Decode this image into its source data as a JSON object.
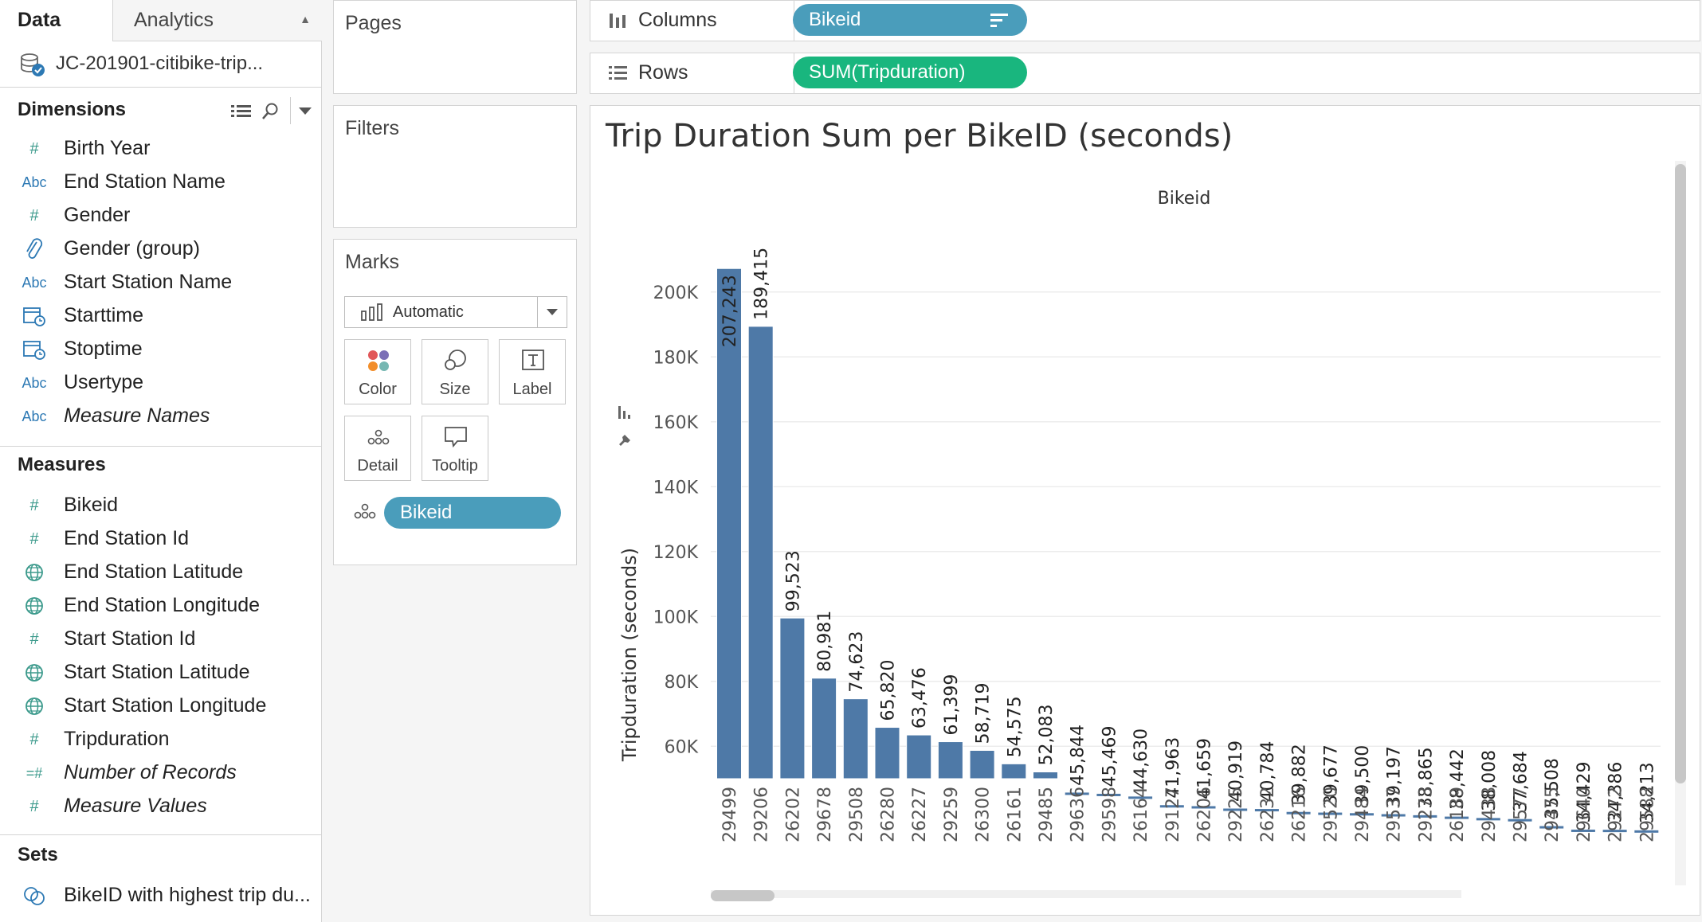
{
  "data_pane": {
    "tab_data": "Data",
    "tab_analytics": "Analytics",
    "datasource": "JC-201901-citibike-trip...",
    "dimensions_title": "Dimensions",
    "dimensions": [
      {
        "label": "Birth Year",
        "icon": "number-icon",
        "italic": false
      },
      {
        "label": "End Station Name",
        "icon": "string-icon",
        "italic": false
      },
      {
        "label": "Gender",
        "icon": "number-icon",
        "italic": false
      },
      {
        "label": "Gender (group)",
        "icon": "paperclip-icon",
        "italic": false
      },
      {
        "label": "Start Station Name",
        "icon": "string-icon",
        "italic": false
      },
      {
        "label": "Starttime",
        "icon": "datetime-icon",
        "italic": false
      },
      {
        "label": "Stoptime",
        "icon": "datetime-icon",
        "italic": false
      },
      {
        "label": "Usertype",
        "icon": "string-icon",
        "italic": false
      },
      {
        "label": "Measure Names",
        "icon": "string-icon",
        "italic": true
      }
    ],
    "measures_title": "Measures",
    "measures": [
      {
        "label": "Bikeid",
        "icon": "number-icon",
        "italic": false
      },
      {
        "label": "End Station Id",
        "icon": "number-icon",
        "italic": false
      },
      {
        "label": "End Station Latitude",
        "icon": "globe-icon",
        "italic": false
      },
      {
        "label": "End Station Longitude",
        "icon": "globe-icon",
        "italic": false
      },
      {
        "label": "Start Station Id",
        "icon": "number-icon",
        "italic": false
      },
      {
        "label": "Start Station Latitude",
        "icon": "globe-icon",
        "italic": false
      },
      {
        "label": "Start Station Longitude",
        "icon": "globe-icon",
        "italic": false
      },
      {
        "label": "Tripduration",
        "icon": "number-icon",
        "italic": false
      },
      {
        "label": "Number of Records",
        "icon": "calculated-number-icon",
        "italic": true
      },
      {
        "label": "Measure Values",
        "icon": "number-icon",
        "italic": true
      }
    ],
    "sets_title": "Sets",
    "sets": [
      {
        "label": "BikeID with highest trip du...",
        "icon": "set-icon"
      }
    ],
    "abc_text": "Abc"
  },
  "cards": {
    "pages": "Pages",
    "filters": "Filters",
    "marks": "Marks",
    "mark_type": "Automatic",
    "mark_buttons": [
      "Color",
      "Size",
      "Label",
      "Detail",
      "Tooltip"
    ],
    "detail_pill": "Bikeid"
  },
  "shelves": {
    "columns_label": "Columns",
    "columns_pill": "Bikeid",
    "rows_label": "Rows",
    "rows_pill": "SUM(Tripduration)"
  },
  "colors": {
    "bar": "#4e79a7",
    "dimension_pill": "#4a9dbb",
    "measure_pill": "#19b67e",
    "field_icon": "#3c9a8c",
    "string_icon": "#2d79b4"
  },
  "chart_data": {
    "type": "bar",
    "title": "Trip Duration Sum per BikeID (seconds)",
    "xlabel": "Bikeid",
    "ylabel": "Tripduration (seconds)",
    "ylim": [
      50000,
      210000
    ],
    "y_ticks": [
      {
        "value": 60000,
        "label": "60K"
      },
      {
        "value": 80000,
        "label": "80K"
      },
      {
        "value": 100000,
        "label": "100K"
      },
      {
        "value": 120000,
        "label": "120K"
      },
      {
        "value": 140000,
        "label": "140K"
      },
      {
        "value": 160000,
        "label": "160K"
      },
      {
        "value": 180000,
        "label": "180K"
      },
      {
        "value": 200000,
        "label": "200K"
      }
    ],
    "grid": true,
    "categories": [
      "29499",
      "29206",
      "26202",
      "29678",
      "29508",
      "26280",
      "26227",
      "29259",
      "26300",
      "26161",
      "29485",
      "29636",
      "29598",
      "26164",
      "29127",
      "26206",
      "29225",
      "26232",
      "26216",
      "29520",
      "29484",
      "29537",
      "29273",
      "26189",
      "29438",
      "29577",
      "29475",
      "29640",
      "29272",
      "29588"
    ],
    "values": [
      207243,
      189415,
      99523,
      80981,
      74623,
      65820,
      63476,
      61399,
      58719,
      54575,
      52083,
      45844,
      45469,
      44630,
      41963,
      41659,
      40919,
      40784,
      39882,
      39677,
      39500,
      39197,
      38865,
      38442,
      38008,
      37684,
      35508,
      34429,
      34386,
      34213
    ],
    "data_labels": [
      "207,243",
      "189,415",
      "99,523",
      "80,981",
      "74,623",
      "65,820",
      "63,476",
      "61,399",
      "58,719",
      "54,575",
      "52,083",
      "45,844",
      "45,469",
      "44,630",
      "41,963",
      "41,659",
      "40,919",
      "40,784",
      "39,882",
      "39,677",
      "39,500",
      "39,197",
      "38,865",
      "38,442",
      "38,008",
      "37,684",
      "35,508",
      "34,429",
      "34,386",
      "34,213"
    ]
  }
}
